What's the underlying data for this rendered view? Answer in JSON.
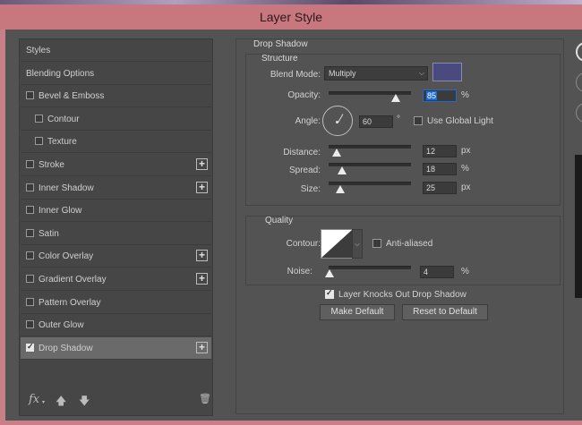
{
  "window": {
    "title": "Layer Style"
  },
  "styles_list": {
    "items": [
      {
        "label": "Styles",
        "checkbox": false,
        "indent": false,
        "plus": false,
        "checked": false,
        "selected": false
      },
      {
        "label": "Blending Options",
        "checkbox": false,
        "indent": false,
        "plus": false,
        "checked": false,
        "selected": false
      },
      {
        "label": "Bevel & Emboss",
        "checkbox": true,
        "indent": false,
        "plus": false,
        "checked": false,
        "selected": false
      },
      {
        "label": "Contour",
        "checkbox": true,
        "indent": true,
        "plus": false,
        "checked": false,
        "selected": false
      },
      {
        "label": "Texture",
        "checkbox": true,
        "indent": true,
        "plus": false,
        "checked": false,
        "selected": false
      },
      {
        "label": "Stroke",
        "checkbox": true,
        "indent": false,
        "plus": true,
        "checked": false,
        "selected": false
      },
      {
        "label": "Inner Shadow",
        "checkbox": true,
        "indent": false,
        "plus": true,
        "checked": false,
        "selected": false
      },
      {
        "label": "Inner Glow",
        "checkbox": true,
        "indent": false,
        "plus": false,
        "checked": false,
        "selected": false
      },
      {
        "label": "Satin",
        "checkbox": true,
        "indent": false,
        "plus": false,
        "checked": false,
        "selected": false
      },
      {
        "label": "Color Overlay",
        "checkbox": true,
        "indent": false,
        "plus": true,
        "checked": false,
        "selected": false
      },
      {
        "label": "Gradient Overlay",
        "checkbox": true,
        "indent": false,
        "plus": true,
        "checked": false,
        "selected": false
      },
      {
        "label": "Pattern Overlay",
        "checkbox": true,
        "indent": false,
        "plus": false,
        "checked": false,
        "selected": false
      },
      {
        "label": "Outer Glow",
        "checkbox": true,
        "indent": false,
        "plus": false,
        "checked": false,
        "selected": false
      },
      {
        "label": "Drop Shadow",
        "checkbox": true,
        "indent": false,
        "plus": true,
        "checked": true,
        "selected": true
      }
    ],
    "footer": {
      "fx_label": "fx",
      "up_icon": "arrow-up-icon",
      "down_icon": "arrow-down-icon",
      "trash_icon": "trash-icon"
    }
  },
  "drop_shadow": {
    "section_title": "Drop Shadow",
    "structure": {
      "title": "Structure",
      "blend_mode_label": "Blend Mode:",
      "blend_mode_value": "Multiply",
      "shadow_color": "#4a4a7e",
      "opacity_label": "Opacity:",
      "opacity_value": "85",
      "opacity_unit": "%",
      "opacity_level": 85,
      "angle_label": "Angle:",
      "angle_value": "60",
      "angle_unit": "°",
      "use_global_light_label": "Use Global Light",
      "use_global_light_checked": false,
      "distance_label": "Distance:",
      "distance_value": "12",
      "distance_unit": "px",
      "spread_label": "Spread:",
      "spread_value": "18",
      "spread_unit": "%",
      "size_label": "Size:",
      "size_value": "25",
      "size_unit": "px"
    },
    "quality": {
      "title": "Quality",
      "contour_label": "Contour:",
      "anti_aliased_label": "Anti-aliased",
      "anti_aliased_checked": false,
      "noise_label": "Noise:",
      "noise_value": "4",
      "noise_unit": "%"
    },
    "layer_knocks_out_label": "Layer Knocks Out Drop Shadow",
    "layer_knocks_out_checked": true,
    "make_default_label": "Make Default",
    "reset_to_default_label": "Reset to Default"
  }
}
